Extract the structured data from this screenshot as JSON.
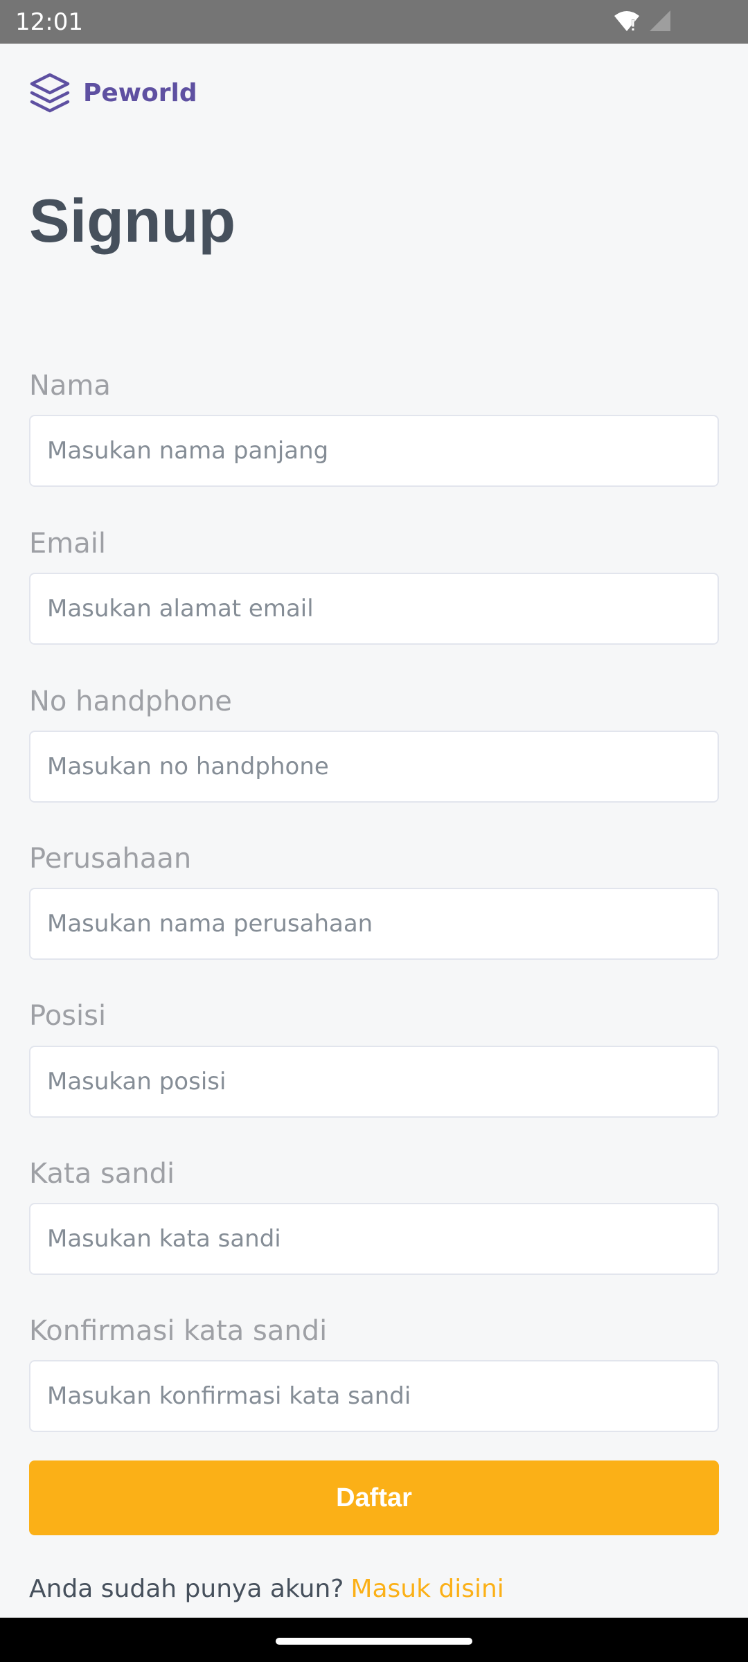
{
  "status_bar": {
    "time": "12:01"
  },
  "brand": {
    "name": "Peworld",
    "color": "#5E50A1"
  },
  "page": {
    "title": "Signup"
  },
  "form": {
    "fields": [
      {
        "label": "Nama",
        "placeholder": "Masukan nama panjang",
        "value": ""
      },
      {
        "label": "Email",
        "placeholder": "Masukan alamat email",
        "value": ""
      },
      {
        "label": "No handphone",
        "placeholder": "Masukan no handphone",
        "value": ""
      },
      {
        "label": "Perusahaan",
        "placeholder": "Masukan nama perusahaan",
        "value": ""
      },
      {
        "label": "Posisi",
        "placeholder": "Masukan posisi",
        "value": ""
      },
      {
        "label": "Kata sandi",
        "placeholder": "Masukan kata sandi",
        "value": ""
      },
      {
        "label": "Konfirmasi kata sandi",
        "placeholder": "Masukan konfirmasi kata sandi",
        "value": ""
      }
    ],
    "submit_label": "Daftar",
    "accent_color": "#FBB017"
  },
  "footer": {
    "prompt": "Anda sudah punya akun?",
    "link": "Masuk disini"
  }
}
